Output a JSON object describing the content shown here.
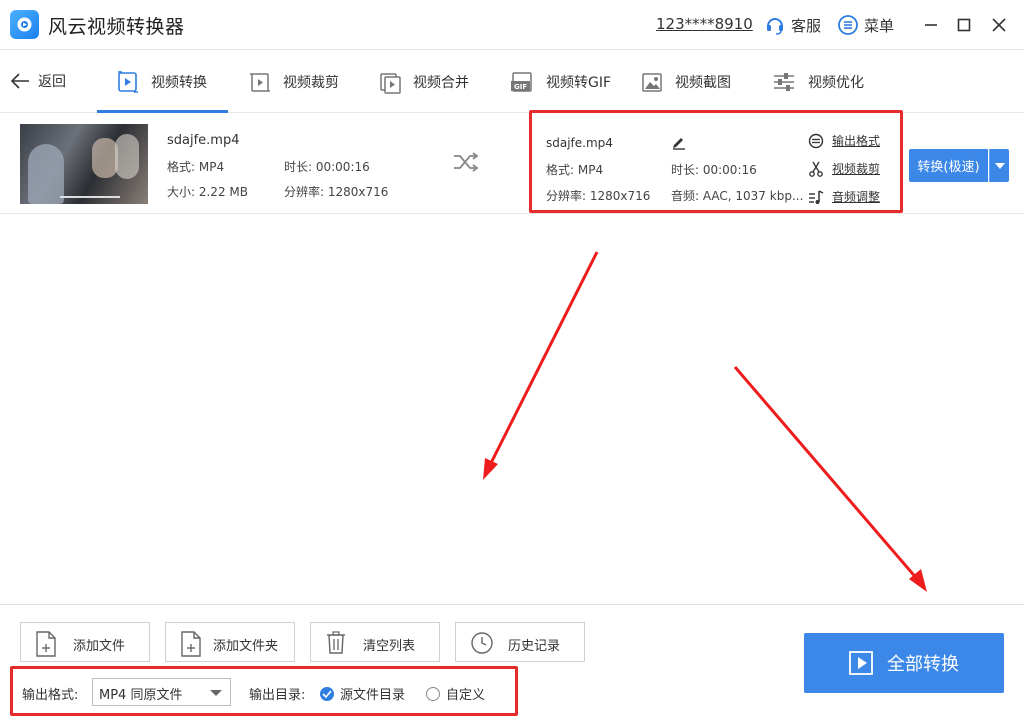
{
  "app": {
    "title": "风云视频转换器",
    "user_id": "123****8910",
    "service_label": "客服",
    "menu_label": "菜单"
  },
  "nav": {
    "back_label": "返回",
    "tabs": [
      {
        "label": "视频转换",
        "icon": "video-convert-icon",
        "active": true
      },
      {
        "label": "视频裁剪",
        "icon": "video-crop-icon",
        "active": false
      },
      {
        "label": "视频合并",
        "icon": "video-merge-icon",
        "active": false
      },
      {
        "label": "视频转GIF",
        "icon": "gif-icon",
        "active": false
      },
      {
        "label": "视频截图",
        "icon": "screenshot-icon",
        "active": false
      },
      {
        "label": "视频优化",
        "icon": "optimize-icon",
        "active": false
      }
    ]
  },
  "file": {
    "name": "sdajfe.mp4",
    "format_label": "格式: MP4",
    "duration_label": "时长: 00:00:16",
    "size_label": "大小: 2.22 MB",
    "resolution_label": "分辨率: 1280x716"
  },
  "output": {
    "name": "sdajfe.mp4",
    "format_label": "格式: MP4",
    "duration_label": "时长: 00:00:16",
    "resolution_label": "分辨率: 1280x716",
    "audio_label": "音频: AAC, 1037 kbp...",
    "links": {
      "output_format": "输出格式",
      "video_crop": "视频裁剪",
      "audio_adjust": "音频调整"
    },
    "convert_label": "转换(极速)"
  },
  "bottom": {
    "add_file": "添加文件",
    "add_folder": "添加文件夹",
    "clear_list": "清空列表",
    "history": "历史记录",
    "format_label": "输出格式:",
    "format_value": "MP4 同原文件",
    "dir_label": "输出目录:",
    "dir_source": "源文件目录",
    "dir_custom": "自定义",
    "convert_all": "全部转换"
  },
  "colors": {
    "accent": "#3c88e8",
    "highlight_box": "#e52b2b"
  }
}
